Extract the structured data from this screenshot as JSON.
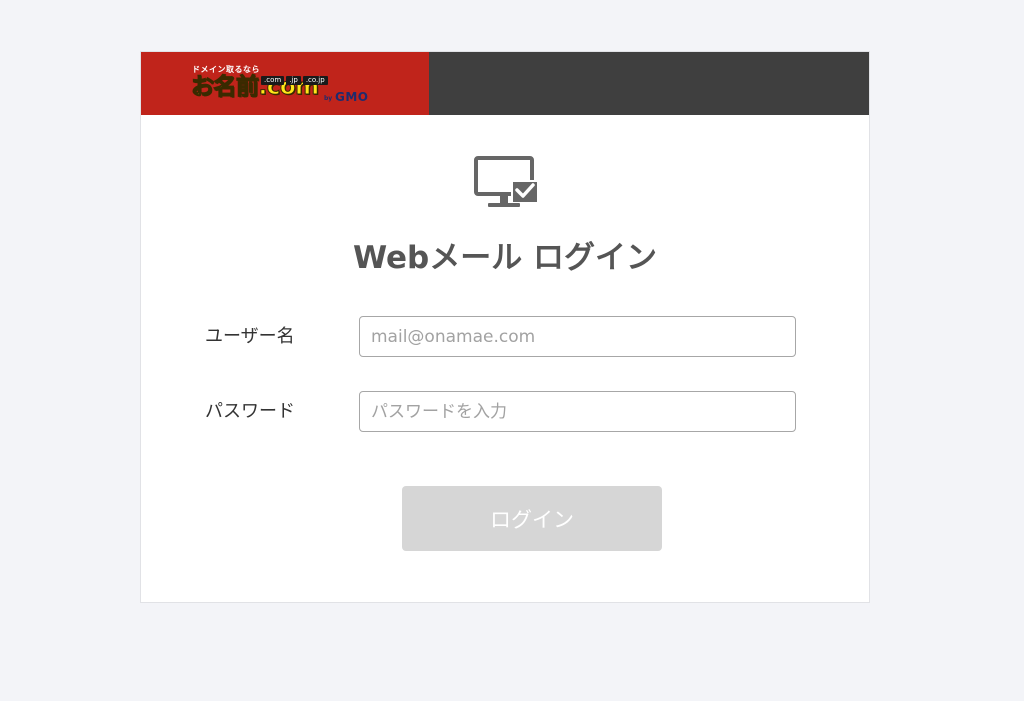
{
  "logo": {
    "tagline": "ドメイン取るなら",
    "brand": "お名前.com",
    "tlds": [
      ".com",
      ".jp",
      ".co.jp"
    ],
    "by": "by",
    "company": "GMO"
  },
  "colors": {
    "logo_red": "#c0241b",
    "header_dark": "#3f3f3f",
    "logo_yellow": "#ffe619",
    "button_disabled": "#d6d6d6"
  },
  "icons": {
    "main": "monitor-check-icon"
  },
  "page": {
    "title": "Webメール ログイン"
  },
  "form": {
    "username": {
      "label": "ユーザー名",
      "placeholder": "mail@onamae.com",
      "value": ""
    },
    "password": {
      "label": "パスワード",
      "placeholder": "パスワードを入力",
      "value": ""
    },
    "submit_label": "ログイン"
  }
}
